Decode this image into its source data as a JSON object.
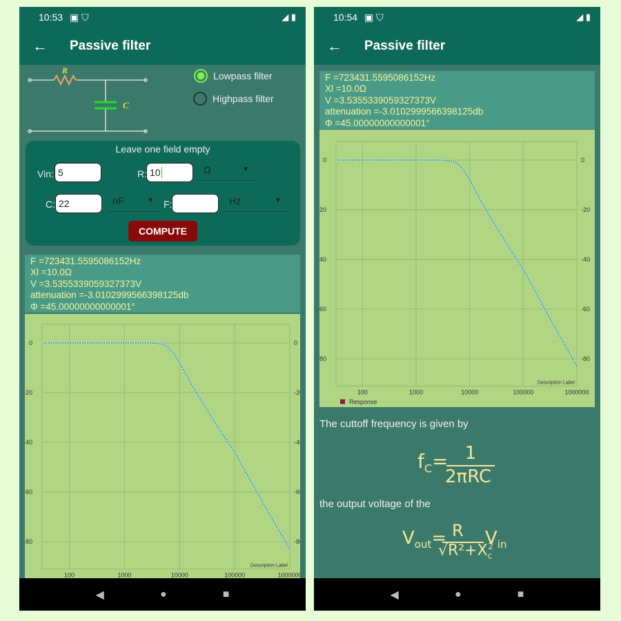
{
  "screens": [
    {
      "time": "10:53",
      "title": "Passive filter"
    },
    {
      "time": "10:54",
      "title": "Passive filter"
    }
  ],
  "circuit": {
    "r_label": "R",
    "c_label": "C"
  },
  "filter_type": {
    "options": [
      "Lowpass filter",
      "Highpass filter"
    ],
    "selected": "Lowpass filter"
  },
  "form": {
    "hint": "Leave one field empty",
    "vin_label": "Vin:",
    "vin_value": "5",
    "r_label": "R:",
    "r_value": "10",
    "r_unit": "Ω",
    "c_label": "C:",
    "c_value": "22",
    "c_unit": "nF",
    "f_label": "F:",
    "f_value": "",
    "f_unit": "Hz",
    "compute": "COMPUTE"
  },
  "results": [
    "F =723431.5595086152Hz",
    "Xl =10.0Ω",
    "V =3.5355339059327373V",
    "attenuation =-3.0102999566398125db",
    "Φ =45.00000000000001°"
  ],
  "chart_data": {
    "type": "line",
    "x_scale": "log",
    "xlim": [
      32,
      1000000
    ],
    "ylim": [
      -91,
      7.5
    ],
    "x_ticks": [
      "100",
      "1000",
      "10000",
      "100000",
      "1000000"
    ],
    "y_ticks": [
      "0",
      "-20",
      "-40",
      "-60",
      "-80"
    ],
    "description": "Description Label",
    "grid": true,
    "legend_position": "bottom-left",
    "series": [
      {
        "name": "Response",
        "legend_color": "#8b1a4a",
        "line_color": "#8ee8f0",
        "x": [
          32,
          100,
          1000,
          3000,
          5000,
          6000,
          7000,
          8000,
          10000,
          20000,
          50000,
          100000,
          300000,
          1000000
        ],
        "y": [
          0,
          0,
          0,
          0,
          -0.5,
          -1.5,
          -3,
          -4.5,
          -8,
          -20,
          -34,
          -44,
          -63,
          -83
        ]
      }
    ]
  },
  "explanation": {
    "cutoff_text": "The cuttoff frequency is given by",
    "output_text": "the output voltage of the"
  },
  "colors": {
    "appbar": "#0e6a58",
    "background": "#3b7a6a",
    "accent": "#7cf04a",
    "button": "#8a0a0a",
    "results_text": "#f5f59a",
    "chart_bg": "#b0d684"
  }
}
